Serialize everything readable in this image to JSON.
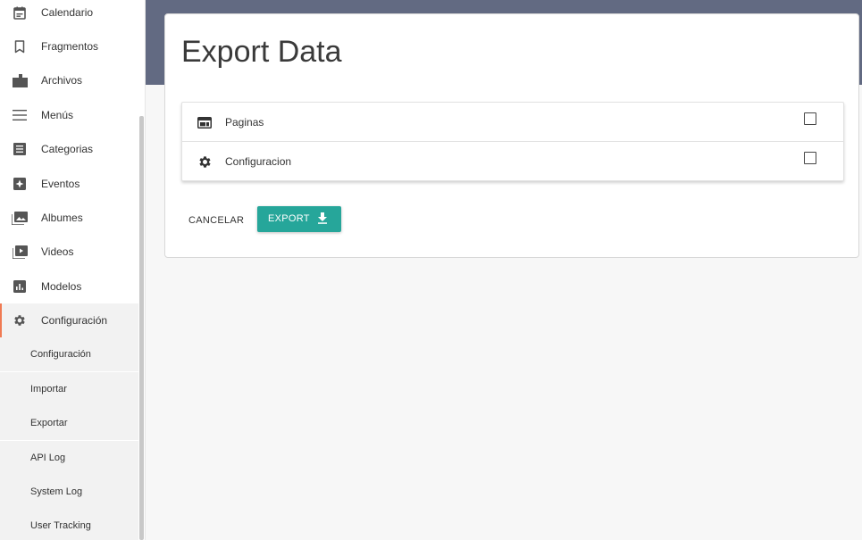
{
  "sidebar": {
    "items": [
      {
        "label": "Calendario",
        "icon": "calendar-icon"
      },
      {
        "label": "Fragmentos",
        "icon": "bookmark-icon"
      },
      {
        "label": "Archivos",
        "icon": "folder-icon"
      },
      {
        "label": "Menús",
        "icon": "menu-icon"
      },
      {
        "label": "Categorias",
        "icon": "list-icon"
      },
      {
        "label": "Eventos",
        "icon": "event-icon"
      },
      {
        "label": "Albumes",
        "icon": "photo-album-icon"
      },
      {
        "label": "Videos",
        "icon": "video-icon"
      },
      {
        "label": "Modelos",
        "icon": "chart-icon"
      },
      {
        "label": "Configuración",
        "icon": "gear-icon",
        "active": true
      }
    ],
    "subitems": [
      {
        "label": "Configuración"
      },
      {
        "label": "Importar"
      },
      {
        "label": "Exportar"
      },
      {
        "label": "API Log"
      },
      {
        "label": "System Log"
      },
      {
        "label": "User Tracking"
      }
    ]
  },
  "main": {
    "title": "Export Data",
    "options": [
      {
        "label": "Paginas",
        "icon": "web-page-icon",
        "checked": false
      },
      {
        "label": "Configuracion",
        "icon": "gear-icon",
        "checked": false
      }
    ],
    "cancel_label": "CANCELAR",
    "export_label": "EXPORT",
    "export_icon": "download-icon"
  },
  "colors": {
    "header_band": "#626a82",
    "accent": "#26a69a",
    "active_marker": "#f07a53"
  }
}
